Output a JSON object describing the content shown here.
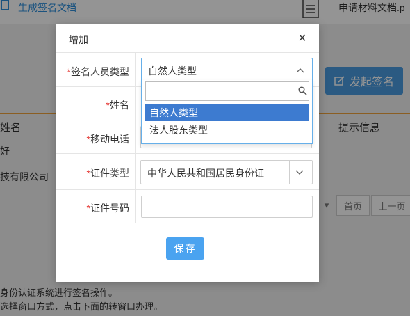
{
  "background": {
    "top_link": "生成签名文档",
    "file_name": "申请材料文档.p",
    "start_button": "发起签名",
    "table_headers": [
      "姓名",
      "提示信息"
    ],
    "rows": [
      "好",
      "技有限公司"
    ],
    "pager": [
      "首页",
      "上一页"
    ],
    "footer_lines": [
      "身份认证系统进行签名操作。",
      "选择窗口方式，点击下面的转窗口办理。"
    ]
  },
  "modal": {
    "title": "增加",
    "close_glyph": "×",
    "fields": {
      "signer_type": {
        "label": "签名人员类型",
        "value": "自然人类型"
      },
      "name": {
        "label": "姓名",
        "value": ""
      },
      "mobile": {
        "label": "移动电话",
        "value": ""
      },
      "id_type": {
        "label": "证件类型",
        "value": "中华人民共和国居民身份证"
      },
      "id_number": {
        "label": "证件号码",
        "value": ""
      }
    },
    "required_mark": "*",
    "dropdown": {
      "search_value": "",
      "options": [
        "自然人类型",
        "法人股东类型"
      ],
      "selected_index": 0
    },
    "save_label": "保存"
  },
  "colors": {
    "accent": "#4aa3f0",
    "selected_option": "#3d7bd0",
    "required": "#e53935",
    "overlay": "rgba(0,0,0,0.42)"
  }
}
